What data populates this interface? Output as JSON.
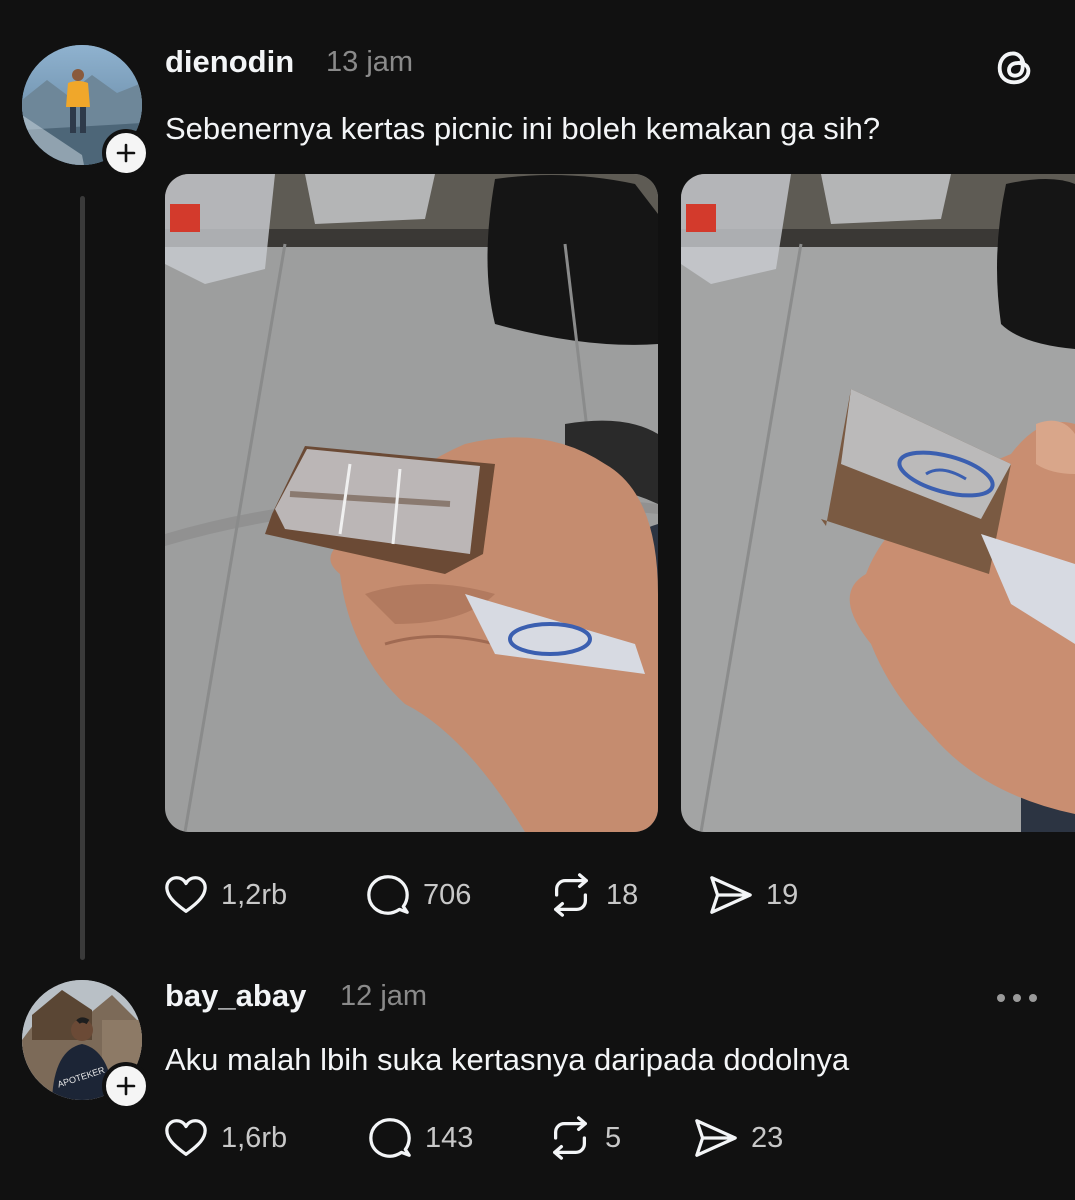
{
  "post": {
    "username": "dienodin",
    "time": "13 jam",
    "text": "Sebenernya kertas picnic ini boleh kemakan ga sih?",
    "wrapper_brand": "picnic",
    "stats": {
      "likes": "1,2rb",
      "replies": "706",
      "reposts": "18",
      "shares": "19"
    }
  },
  "reply": {
    "username": "bay_abay",
    "time": "12 jam",
    "text": "Aku malah lbih suka kertasnya daripada dodolnya",
    "jacket_text": "APOTEKER",
    "stats": {
      "likes": "1,6rb",
      "replies": "143",
      "reposts": "5",
      "shares": "23"
    }
  },
  "icons": {
    "app": "threads-icon",
    "follow": "plus-icon",
    "like": "heart-icon",
    "reply": "speech-bubble-icon",
    "repost": "repost-icon",
    "share": "paper-plane-icon",
    "more": "more-dots-icon"
  },
  "colors": {
    "background": "#111111",
    "text": "#f3f5f7",
    "muted": "#8a8a8a",
    "thread_line": "#3a3a3a"
  }
}
